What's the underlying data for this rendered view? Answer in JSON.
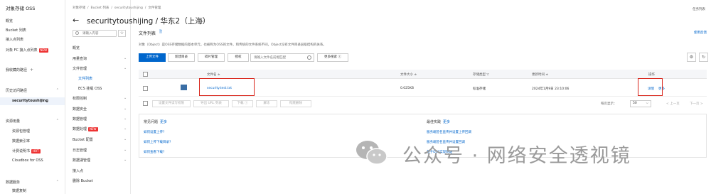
{
  "left_nav": {
    "brand": "对象存储 OSS",
    "items": [
      "概览",
      "Bucket 列表",
      "接入点列表",
      "对象 FC 接入点列表"
    ],
    "badge_new": "NEW",
    "favorites": "我收藏的路径",
    "history": "历史访问路径",
    "history_active": "securitytoushijing",
    "resource_group": "资源用量",
    "resource_items": [
      "资源包管理",
      "数据索引率",
      "计费说明书",
      "Cloudbox for OSS"
    ],
    "hot_badge": "HOT",
    "data_service": "数据服务",
    "data_service_item": "数据复制"
  },
  "header": {
    "breadcrumb": [
      "对象存储",
      "/",
      "Bucket 列表",
      "/",
      "securitytoushijing",
      "/",
      "文件管理"
    ],
    "top_right": "任务列表",
    "bucket_title": "securitytoushijing / 华东2（上海）"
  },
  "sec_nav": {
    "search_placeholder": "请输入内容",
    "items": [
      {
        "label": "概览",
        "sub": false,
        "chev": false
      },
      {
        "label": "用量查询",
        "sub": false,
        "chev": true
      },
      {
        "label": "文件管理",
        "sub": false,
        "chev": true
      },
      {
        "label": "文件列表",
        "sub": true,
        "chev": false,
        "active": true
      },
      {
        "label": "ECS 挂载 OSS",
        "sub": true,
        "chev": false
      },
      {
        "label": "权限控制",
        "sub": false,
        "chev": true
      },
      {
        "label": "数据安全",
        "sub": false,
        "chev": true
      },
      {
        "label": "数据管理",
        "sub": false,
        "chev": true
      },
      {
        "label": "数据处理",
        "sub": false,
        "chev": true,
        "badge": "NEW"
      },
      {
        "label": "Bucket 配置",
        "sub": false,
        "chev": true
      },
      {
        "label": "日志管理",
        "sub": false,
        "chev": true
      },
      {
        "label": "数据湖管理",
        "sub": false,
        "chev": true
      },
      {
        "label": "接入点",
        "sub": false,
        "chev": false
      },
      {
        "label": "删除 Bucket",
        "sub": false,
        "chev": false
      }
    ]
  },
  "main": {
    "title": "文件列表",
    "right_link": "使用反馈",
    "description": "对象（Object）是OSS存储数据的基本单元，也被称为OSS的文件。和传统的文件系统不同，Object没有文件目录层级结构的关系。",
    "toolbar": {
      "upload": "上传文件",
      "new_dir": "新建目录",
      "fragments": "碎片管理",
      "authorize": "授权",
      "search_placeholder": "请输入文件名前缀匹配",
      "more_search": "更多搜索 ⓘ"
    },
    "table": {
      "headers": [
        "文件名 ≑",
        "文件大小 ≑",
        "存储类型 ▽",
        "更新时间 ≑",
        "操作"
      ],
      "rows": [
        {
          "name": "security.test.txt",
          "size": "0.025KB",
          "storage": "标准存储",
          "updated": "2024年1月9日 23:10:06",
          "action": "详情",
          "more": "更多"
        }
      ]
    },
    "bulk_actions": [
      "设置文件读写权限",
      "导出 URL 列表",
      "下载 ⓘ",
      "解冻",
      "彻底删除"
    ],
    "pager": {
      "per_page_label": "每页显示：",
      "per_page": "50",
      "prev": "< 上一页",
      "next": "下一页 >"
    },
    "help": {
      "faq_title": "常见问题",
      "faq_more": "更多",
      "faq_links": [
        "如何设置上传?",
        "如何上传下载目录?",
        "如何查看下载?"
      ],
      "best_title": "最佳实践",
      "best_more": "更多",
      "best_links": [
        "服务端签名直传并设置上传回调",
        "服务端签名直传并设置回调",
        "基于OSS实现网站"
      ]
    }
  },
  "watermark": "公众号 · 网络安全透视镜",
  "colors": {
    "accent": "#0066cc",
    "highlight": "#d9261c",
    "badge": "#e33333"
  }
}
